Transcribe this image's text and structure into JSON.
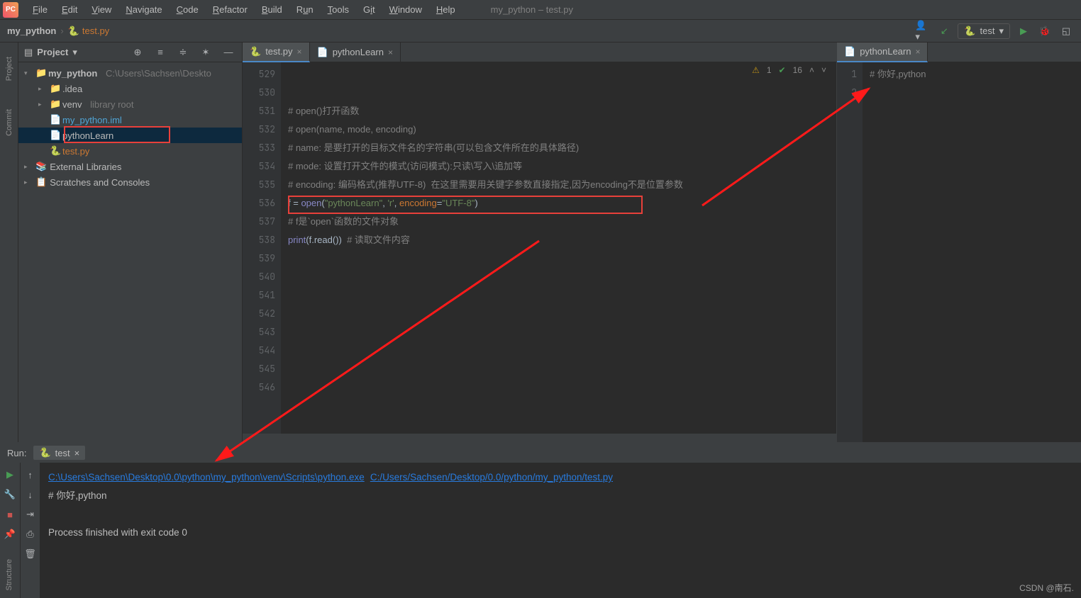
{
  "window_title": "my_python – test.py",
  "menu": {
    "file": "File",
    "edit": "Edit",
    "view": "View",
    "navigate": "Navigate",
    "code": "Code",
    "refactor": "Refactor",
    "build": "Build",
    "run": "Run",
    "tools": "Tools",
    "git": "Git",
    "window": "Window",
    "help": "Help"
  },
  "breadcrumb": {
    "root": "my_python",
    "file": "test.py"
  },
  "run_config_name": "test",
  "gutters": {
    "project": "Project",
    "commit": "Commit",
    "structure": "Structure"
  },
  "project_panel": {
    "title": "Project",
    "root": "my_python",
    "root_path": "C:\\Users\\Sachsen\\Deskto",
    "idea": ".idea",
    "venv": "venv",
    "venv_hint": "library root",
    "iml": "my_python.iml",
    "pl": "pythonLearn",
    "testpy": "test.py",
    "ext": "External Libraries",
    "scratch": "Scratches and Consoles"
  },
  "tabs_left": [
    {
      "label": "test.py"
    },
    {
      "label": "pythonLearn"
    }
  ],
  "tabs_right": [
    {
      "label": "pythonLearn"
    }
  ],
  "editor_status": {
    "warn": "1",
    "ok": "16"
  },
  "line_start": 529,
  "line_end": 546,
  "code_lines": [
    "",
    "",
    "# open()打开函数",
    "# open(name, mode, encoding)",
    "# name: 是要打开的目标文件名的字符串(可以包含文件所在的具体路径)",
    "# mode: 设置打开文件的模式(访问模式):只读\\写入\\追加等",
    "# encoding: 编码格式(推荐UTF-8)  在这里需要用关键字参数直接指定,因为encoding不是位置参数",
    "f = open(\"pythonLearn\", 'r', encoding=\"UTF-8\")",
    "# f是`open`函数的文件对象",
    "print(f.read())  # 读取文件内容",
    "",
    "",
    "",
    "",
    "",
    "",
    "",
    ""
  ],
  "right_editor": {
    "line1": "# 你好,python"
  },
  "run_panel": {
    "label": "Run:",
    "tab": "test",
    "exe_path": "C:\\Users\\Sachsen\\Desktop\\0.0\\python\\my_python\\venv\\Scripts\\python.exe",
    "script_path": "C:/Users/Sachsen/Desktop/0.0/python/my_python/test.py",
    "out1": "# 你好,python",
    "out2": "Process finished with exit code 0"
  },
  "watermark": "CSDN @南石."
}
